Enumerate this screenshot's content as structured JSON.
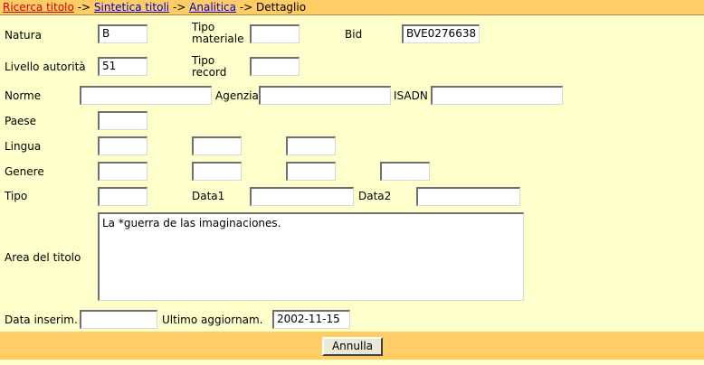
{
  "breadcrumb": {
    "link1": "Ricerca titolo",
    "link2": "Sintetica titoli",
    "link3": "Analitica",
    "sep": "->",
    "current": "Dettaglio"
  },
  "labels": {
    "natura": "Natura",
    "tipo_materiale_1": "Tipo",
    "tipo_materiale_2": "materiale",
    "bid": "Bid",
    "livello": "Livello autorità",
    "tipo_record_1": "Tipo",
    "tipo_record_2": "record",
    "norme": "Norme",
    "agenzia": "Agenzia",
    "isadn": "ISADN",
    "paese": "Paese",
    "lingua": "Lingua",
    "genere": "Genere",
    "tipo": "Tipo",
    "data1": "Data1",
    "data2": "Data2",
    "area": "Area del titolo",
    "data_inserim": "Data inserim.",
    "ultimo": "Ultimo aggiornam."
  },
  "values": {
    "natura": "B",
    "tipo_materiale": "",
    "bid": "BVE0276638",
    "livello": "51",
    "tipo_record": "",
    "norme": "",
    "agenzia": "",
    "isadn": "",
    "paese": "",
    "lingua": [
      "",
      "",
      ""
    ],
    "genere": [
      "",
      "",
      "",
      ""
    ],
    "tipo": "",
    "data1": "",
    "data2": "",
    "area": "La *guerra de las imaginaciones.",
    "data_inserim": "",
    "ultimo": "2002-11-15"
  },
  "button": {
    "annulla": "Annulla"
  },
  "colors": {
    "bar": "#ffcc66",
    "panel": "#ffffcc"
  }
}
